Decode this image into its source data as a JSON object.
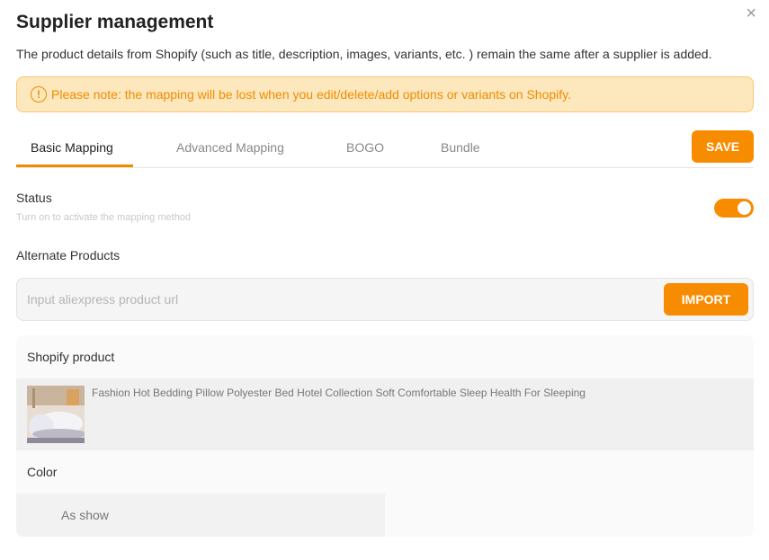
{
  "header": {
    "title": "Supplier management",
    "close_icon": "×",
    "description": "The product details from Shopify (such as title, description, images, variants, etc. ) remain the same after a supplier is added."
  },
  "notice": {
    "icon": "!",
    "text": "Please note: the mapping will be lost when you edit/delete/add options or variants on Shopify.",
    "color": "#f08c00",
    "background": "#fde7bd"
  },
  "tabs": [
    {
      "label": "Basic Mapping",
      "active": true
    },
    {
      "label": "Advanced Mapping",
      "active": false
    },
    {
      "label": "BOGO",
      "active": false
    },
    {
      "label": "Bundle",
      "active": false
    }
  ],
  "save_label": "SAVE",
  "status": {
    "label": "Status",
    "hint": "Turn on to activate the mapping method",
    "enabled": true
  },
  "alternate": {
    "label": "Alternate Products",
    "placeholder": "Input aliexpress product url",
    "value": "",
    "import_label": "IMPORT"
  },
  "shopify_product": {
    "title": "Shopify product",
    "name": "Fashion Hot Bedding Pillow Polyester Bed Hotel Collection Soft Comfortable Sleep Health For Sleeping",
    "image_icon": "pillow-image"
  },
  "options": {
    "label": "Color",
    "values": [
      "As show"
    ]
  },
  "accent_color": "#f88c00"
}
